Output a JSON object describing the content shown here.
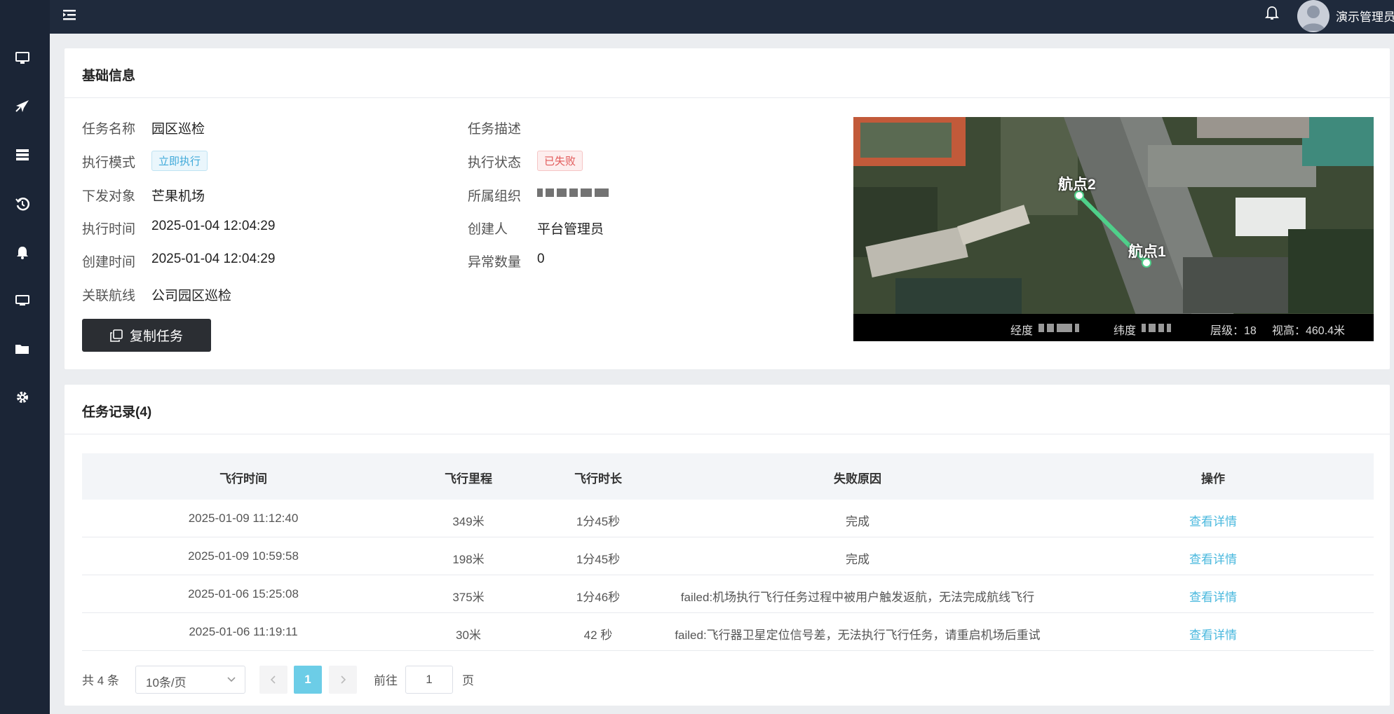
{
  "header": {
    "user_name": "演示管理员"
  },
  "sidebar": {
    "items": [
      {
        "icon": "monitor-icon"
      },
      {
        "icon": "airplane-icon"
      },
      {
        "icon": "list-icon"
      },
      {
        "icon": "history-icon"
      },
      {
        "icon": "bell-icon"
      },
      {
        "icon": "screen-icon"
      },
      {
        "icon": "folder-icon"
      },
      {
        "icon": "gear-icon"
      }
    ]
  },
  "basic": {
    "title": "基础信息",
    "task_name_label": "任务名称",
    "task_name": "园区巡检",
    "exec_mode_label": "执行模式",
    "exec_mode": "立即执行",
    "target_label": "下发对象",
    "target": "芒果机场",
    "exec_time_label": "执行时间",
    "exec_time": "2025-01-04 12:04:29",
    "create_time_label": "创建时间",
    "create_time": "2025-01-04 12:04:29",
    "route_label": "关联航线",
    "route": "公司园区巡检",
    "desc_label": "任务描述",
    "desc": "",
    "status_label": "执行状态",
    "status": "已失败",
    "org_label": "所属组织",
    "creator_label": "创建人",
    "creator": "平台管理员",
    "anomaly_label": "异常数量",
    "anomaly": "0",
    "copy_button": "复制任务"
  },
  "map": {
    "waypoint1": "航点1",
    "waypoint2": "航点2",
    "lng_label": "经度",
    "lat_label": "纬度",
    "level_text": "层级：18",
    "height_text": "视高：460.4米"
  },
  "records": {
    "title": "任务记录(4)",
    "columns": [
      "飞行时间",
      "飞行里程",
      "飞行时长",
      "失败原因",
      "操作"
    ],
    "rows": [
      {
        "time": "2025-01-09 11:12:40",
        "distance": "349米",
        "duration": "1分45秒",
        "reason": "完成",
        "action": "查看详情"
      },
      {
        "time": "2025-01-09 10:59:58",
        "distance": "198米",
        "duration": "1分45秒",
        "reason": "完成",
        "action": "查看详情"
      },
      {
        "time": "2025-01-06 15:25:08",
        "distance": "375米",
        "duration": "1分46秒",
        "reason": "failed:机场执行飞行任务过程中被用户触发返航，无法完成航线飞行",
        "action": "查看详情"
      },
      {
        "time": "2025-01-06 11:19:11",
        "distance": "30米",
        "duration": "42 秒",
        "reason": "failed:飞行器卫星定位信号差，无法执行飞行任务，请重启机场后重试",
        "action": "查看详情"
      }
    ]
  },
  "pagination": {
    "total": "共 4 条",
    "page_size": "10条/页",
    "current_page": "1",
    "goto_label": "前往",
    "goto_value": "1",
    "goto_suffix": "页"
  }
}
